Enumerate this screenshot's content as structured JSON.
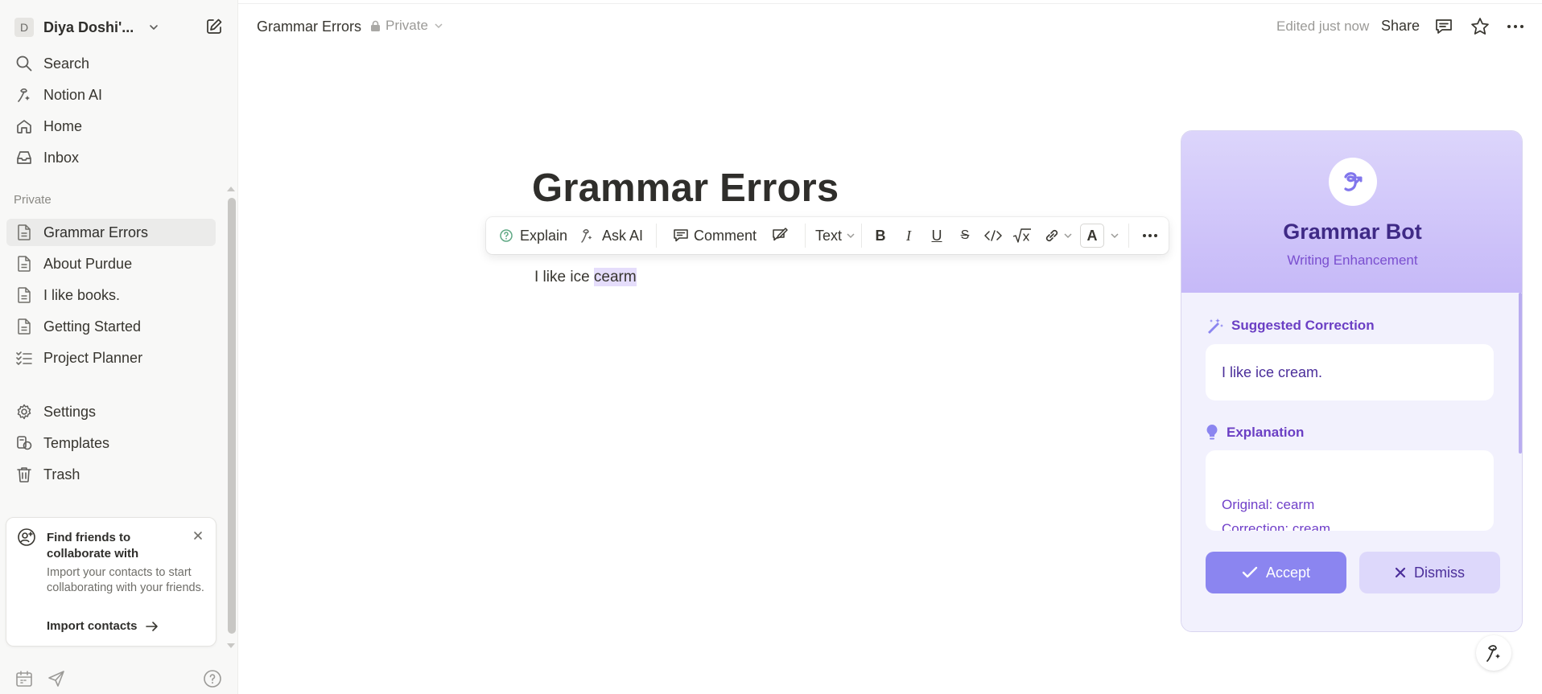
{
  "workspace": {
    "avatar": "D",
    "name": "Diya Doshi'..."
  },
  "sidebar": {
    "nav": [
      {
        "label": "Search",
        "icon": "search-icon"
      },
      {
        "label": "Notion AI",
        "icon": "notion-ai-icon"
      },
      {
        "label": "Home",
        "icon": "home-icon"
      },
      {
        "label": "Inbox",
        "icon": "inbox-icon"
      }
    ],
    "section_label": "Private",
    "pages": [
      {
        "label": "Grammar Errors",
        "icon": "page-icon",
        "active": true
      },
      {
        "label": "About Purdue",
        "icon": "page-icon"
      },
      {
        "label": "I like books.",
        "icon": "page-icon"
      },
      {
        "label": "Getting Started",
        "icon": "page-icon"
      },
      {
        "label": "Project Planner",
        "icon": "checklist-icon"
      }
    ],
    "utility": [
      {
        "label": "Settings",
        "icon": "gear-icon"
      },
      {
        "label": "Templates",
        "icon": "templates-icon"
      },
      {
        "label": "Trash",
        "icon": "trash-icon"
      }
    ],
    "card": {
      "title": "Find friends to collaborate with",
      "body": "Import your contacts to start collaborating with your friends.",
      "link": "Import contacts"
    }
  },
  "topbar": {
    "breadcrumb": "Grammar Errors",
    "privacy": "Private",
    "edited": "Edited just now",
    "share": "Share"
  },
  "editor": {
    "title": "Grammar Errors",
    "text_before": "I like ice ",
    "text_selected": "cearm"
  },
  "toolbar": {
    "explain": "Explain",
    "ask_ai": "Ask AI",
    "comment": "Comment",
    "text_type": "Text",
    "color_letter": "A"
  },
  "grammar_bot": {
    "title": "Grammar Bot",
    "subtitle": "Writing Enhancement",
    "correction_label": "Suggested Correction",
    "correction_text": "I like ice cream.",
    "explanation_label": "Explanation",
    "explanation_original": "Original: cearm",
    "explanation_correction": "Correction: cream",
    "accept": "Accept",
    "dismiss": "Dismiss",
    "accent": "#8b85f0"
  }
}
